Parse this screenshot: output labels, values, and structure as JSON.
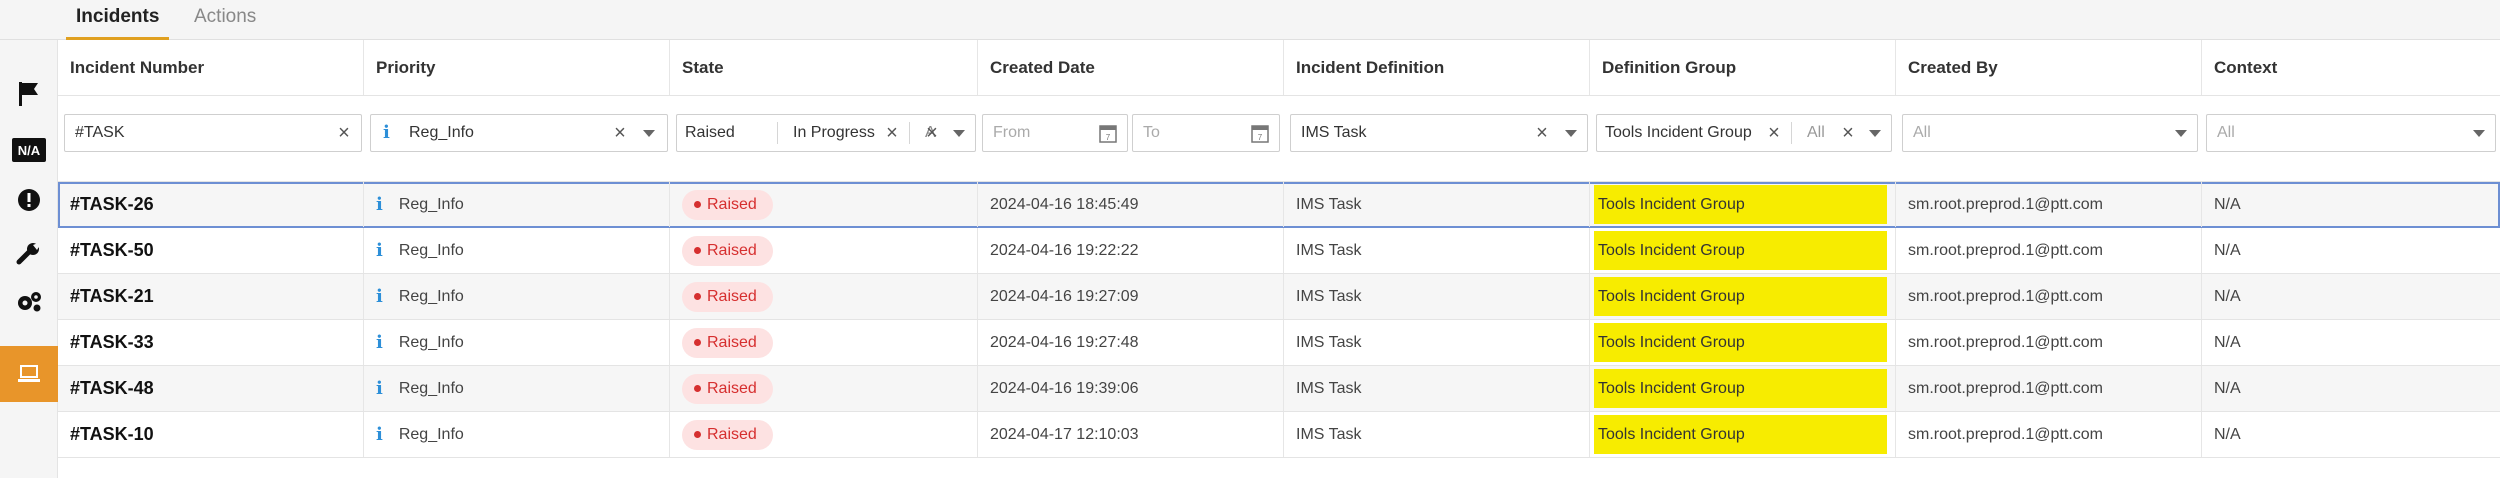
{
  "tabs": [
    {
      "label": "Incidents",
      "active": true
    },
    {
      "label": "Actions",
      "active": false
    }
  ],
  "sidebar": {
    "items": [
      {
        "icon": "flag-icon"
      },
      {
        "icon": "na-icon",
        "text": "N/A"
      },
      {
        "icon": "alert-icon"
      },
      {
        "icon": "wrench-icon"
      },
      {
        "icon": "gears-icon"
      },
      {
        "icon": "laptop-icon",
        "active": true
      }
    ],
    "accent": "#e8952a"
  },
  "columns": [
    "Incident Number",
    "Priority",
    "State",
    "Created Date",
    "Incident Definition",
    "Definition Group",
    "Created By",
    "Context"
  ],
  "filters": {
    "incident_number": "#TASK",
    "priority": "Reg_Info",
    "state_chips": [
      "Raised",
      "In Progress",
      "A"
    ],
    "created_from_placeholder": "From",
    "created_to_placeholder": "To",
    "incident_definition": "IMS Task",
    "definition_group_chip": "Tools Incident Group",
    "definition_group_second": "All",
    "created_by_placeholder": "All",
    "context_placeholder": "All"
  },
  "rows": [
    {
      "number": "#TASK-26",
      "priority": "Reg_Info",
      "state": "Raised",
      "created": "2024-04-16 18:45:49",
      "definition": "IMS Task",
      "group": "Tools Incident Group",
      "created_by": "sm.root.preprod.1@ptt.com",
      "context": "N/A"
    },
    {
      "number": "#TASK-50",
      "priority": "Reg_Info",
      "state": "Raised",
      "created": "2024-04-16 19:22:22",
      "definition": "IMS Task",
      "group": "Tools Incident Group",
      "created_by": "sm.root.preprod.1@ptt.com",
      "context": "N/A"
    },
    {
      "number": "#TASK-21",
      "priority": "Reg_Info",
      "state": "Raised",
      "created": "2024-04-16 19:27:09",
      "definition": "IMS Task",
      "group": "Tools Incident Group",
      "created_by": "sm.root.preprod.1@ptt.com",
      "context": "N/A"
    },
    {
      "number": "#TASK-33",
      "priority": "Reg_Info",
      "state": "Raised",
      "created": "2024-04-16 19:27:48",
      "definition": "IMS Task",
      "group": "Tools Incident Group",
      "created_by": "sm.root.preprod.1@ptt.com",
      "context": "N/A"
    },
    {
      "number": "#TASK-48",
      "priority": "Reg_Info",
      "state": "Raised",
      "created": "2024-04-16 19:39:06",
      "definition": "IMS Task",
      "group": "Tools Incident Group",
      "created_by": "sm.root.preprod.1@ptt.com",
      "context": "N/A"
    },
    {
      "number": "#TASK-10",
      "priority": "Reg_Info",
      "state": "Raised",
      "created": "2024-04-17 12:10:03",
      "definition": "IMS Task",
      "group": "Tools Incident Group",
      "created_by": "sm.root.preprod.1@ptt.com",
      "context": "N/A"
    }
  ],
  "colors": {
    "highlight": "#f7ec00",
    "raised_bg": "#fde2e2",
    "raised_text": "#d62f2f",
    "info": "#2d8fd8",
    "selected_outline": "#6d8fd3"
  }
}
